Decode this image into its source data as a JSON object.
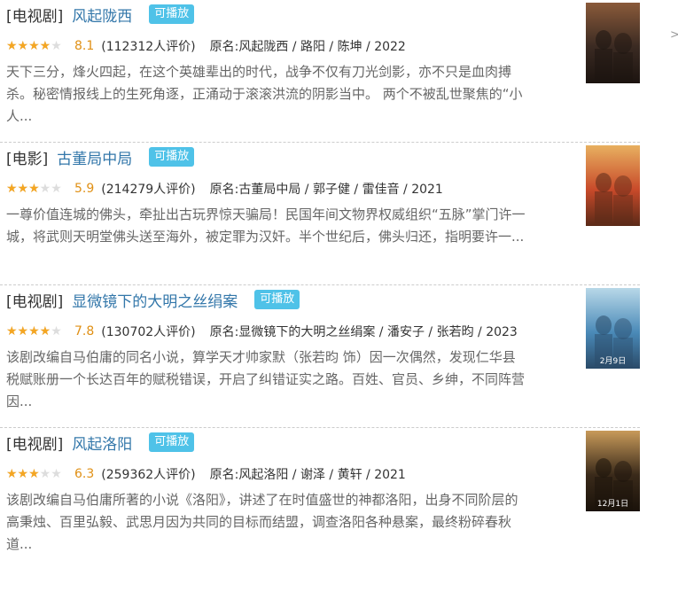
{
  "nav": {
    "next_glyph": ">"
  },
  "items": [
    {
      "category": "[电视剧]",
      "title": "风起陇西",
      "badge": "可播放",
      "rating": 8.1,
      "rating_text": "8.1",
      "stars_filled": 4,
      "stars_total": 5,
      "reviews": "(112312人评价)",
      "info": "原名:风起陇西 / 路阳 / 陈坤 / 2022",
      "desc_lines": [
        "天下三分，烽火四起，在这个英雄辈出的时代，战争不仅有刀光剑影，亦不只是血肉搏",
        "杀。秘密情报线上的生死角逐，正涌动于滚滚洪流的阴影当中。 两个不被乱世聚焦的“小",
        "人..."
      ],
      "poster": {
        "colors": [
          "#3a2a22",
          "#8a5a3a",
          "#1c1410"
        ]
      }
    },
    {
      "category": "[电影]",
      "title": "古董局中局",
      "badge": "可播放",
      "rating": 5.9,
      "rating_text": "5.9",
      "stars_filled": 3,
      "stars_total": 5,
      "reviews": "(214279人评价)",
      "info": "原名:古董局中局 / 郭子健 / 雷佳音 / 2021",
      "desc_lines": [
        "一尊价值连城的佛头，牵扯出古玩界惊天骗局！民国年间文物界权威组织“五脉”掌门许一",
        "城，将武则天明堂佛头送至海外，被定罪为汉奸。半个世纪后，佛头归还，指明要许一..."
      ],
      "poster": {
        "colors": [
          "#c84a2a",
          "#e8b060",
          "#5a2a18"
        ]
      }
    },
    {
      "category": "[电视剧]",
      "title": "显微镜下的大明之丝绢案",
      "badge": "可播放",
      "rating": 7.8,
      "rating_text": "7.8",
      "stars_filled": 4,
      "stars_total": 5,
      "reviews": "(130702人评价)",
      "info": "原名:显微镜下的大明之丝绢案 / 潘安子 / 张若昀 / 2023",
      "desc_lines": [
        "该剧改编自马伯庸的同名小说，算学天才帅家默（张若昀 饰）因一次偶然，发现仁华县",
        "税赋账册一个长达百年的赋税错误，开启了纠错证实之路。百姓、官员、乡绅，不同阵营",
        "因..."
      ],
      "poster": {
        "colors": [
          "#4a8ab8",
          "#b8d8e8",
          "#2a4a68"
        ],
        "label": "2月9日"
      }
    },
    {
      "category": "[电视剧]",
      "title": "风起洛阳",
      "badge": "可播放",
      "rating": 6.3,
      "rating_text": "6.3",
      "stars_filled": 3,
      "stars_total": 5,
      "reviews": "(259362人评价)",
      "info": "原名:风起洛阳 / 谢泽 / 黄轩 / 2021",
      "desc_lines": [
        "该剧改编自马伯庸所著的小说《洛阳》，讲述了在时值盛世的神都洛阳，出身不同阶层的",
        "高秉烛、百里弘毅、武思月因为共同的目标而结盟，调查洛阳各种悬案，最终粉碎春秋",
        "道..."
      ],
      "poster": {
        "colors": [
          "#3a2a1a",
          "#c89a5a",
          "#1a120a"
        ],
        "label": "12月1日"
      }
    }
  ]
}
